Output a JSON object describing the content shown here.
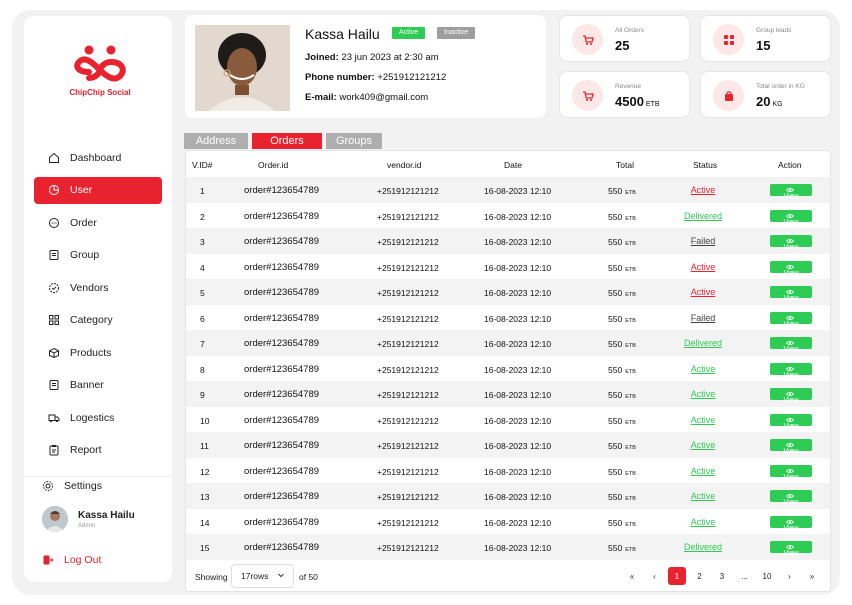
{
  "brand": {
    "name": "ChipChip Social",
    "color": "#e8232f"
  },
  "sidebar": {
    "items": [
      {
        "label": "Dashboard",
        "icon": "home-icon"
      },
      {
        "label": "User",
        "icon": "user-pie-icon"
      },
      {
        "label": "Order",
        "icon": "chat-icon"
      },
      {
        "label": "Group",
        "icon": "document-icon"
      },
      {
        "label": "Vendors",
        "icon": "badge-icon"
      },
      {
        "label": "Category",
        "icon": "grid-icon"
      },
      {
        "label": "Products",
        "icon": "box-icon"
      },
      {
        "label": "Banner",
        "icon": "document-icon"
      },
      {
        "label": "Logestics",
        "icon": "truck-icon"
      },
      {
        "label": "Report",
        "icon": "clipboard-icon"
      }
    ],
    "active_index": 1,
    "settings_label": "Settings",
    "user": {
      "name": "Kassa Hailu",
      "role": "Admin"
    },
    "logout_label": "Log Out"
  },
  "profile": {
    "name": "Kassa Hailu",
    "active_label": "Active",
    "inactive_label": "Inactive",
    "joined_label": "Joined:",
    "joined_value": "23 jun 2023 at 2:30 am",
    "phone_label": "Phone number:",
    "phone_value": "+251912121212",
    "email_label": "E-mail:",
    "email_value": "work409@gmail.com"
  },
  "stats": [
    {
      "label": "All Orders",
      "value": "25",
      "unit": "",
      "icon": "cart-icon"
    },
    {
      "label": "Group leads",
      "value": "15",
      "unit": "",
      "icon": "grid-icon"
    },
    {
      "label": "Revenue",
      "value": "4500",
      "unit": "ETB",
      "icon": "cart-icon"
    },
    {
      "label": "Total order in KG",
      "value": "20",
      "unit": "KG",
      "icon": "bag-icon"
    }
  ],
  "tabs": [
    "Address",
    "Orders",
    "Groups"
  ],
  "selected_tab": "Orders",
  "table": {
    "headers": [
      "V.ID#",
      "Order.id",
      "vendor.id",
      "Date",
      "Total",
      "Status",
      "Action"
    ],
    "rows": [
      {
        "vid": "1",
        "order": "order#123654789",
        "vendor": "+251912121212",
        "date": "16-08-2023 12:10",
        "total": "550",
        "currency": "ETB",
        "status": "Active",
        "action": "View"
      },
      {
        "vid": "2",
        "order": "order#123654789",
        "vendor": "+251912121212",
        "date": "16-08-2023 12:10",
        "total": "550",
        "currency": "ETB",
        "status": "Delivered",
        "action": "View"
      },
      {
        "vid": "3",
        "order": "order#123654789",
        "vendor": "+251912121212",
        "date": "16-08-2023 12:10",
        "total": "550",
        "currency": "ETB",
        "status": "Failed",
        "action": "View"
      },
      {
        "vid": "4",
        "order": "order#123654789",
        "vendor": "+251912121212",
        "date": "16-08-2023 12:10",
        "total": "550",
        "currency": "ETB",
        "status": "Active",
        "action": "View"
      },
      {
        "vid": "5",
        "order": "order#123654789",
        "vendor": "+251912121212",
        "date": "16-08-2023 12:10",
        "total": "550",
        "currency": "ETB",
        "status": "Active",
        "action": "View"
      },
      {
        "vid": "6",
        "order": "order#123654789",
        "vendor": "+251912121212",
        "date": "16-08-2023 12:10",
        "total": "550",
        "currency": "ETB",
        "status": "Failed",
        "action": "View"
      },
      {
        "vid": "7",
        "order": "order#123654789",
        "vendor": "+251912121212",
        "date": "16-08-2023 12:10",
        "total": "550",
        "currency": "ETB",
        "status": "Delivered",
        "action": "View"
      },
      {
        "vid": "8",
        "order": "order#123654789",
        "vendor": "+251912121212",
        "date": "16-08-2023 12:10",
        "total": "550",
        "currency": "ETB",
        "status": "Active",
        "action": "View"
      },
      {
        "vid": "9",
        "order": "order#123654789",
        "vendor": "+251912121212",
        "date": "16-08-2023 12:10",
        "total": "550",
        "currency": "ETB",
        "status": "Active",
        "action": "View"
      },
      {
        "vid": "10",
        "order": "order#123654789",
        "vendor": "+251912121212",
        "date": "16-08-2023 12:10",
        "total": "550",
        "currency": "ETB",
        "status": "Active",
        "action": "View"
      },
      {
        "vid": "11",
        "order": "order#123654789",
        "vendor": "+251912121212",
        "date": "16-08-2023 12:10",
        "total": "550",
        "currency": "ETB",
        "status": "Active",
        "action": "View"
      },
      {
        "vid": "12",
        "order": "order#123654789",
        "vendor": "+251912121212",
        "date": "16-08-2023 12:10",
        "total": "550",
        "currency": "ETB",
        "status": "Active",
        "action": "View"
      },
      {
        "vid": "13",
        "order": "order#123654789",
        "vendor": "+251912121212",
        "date": "16-08-2023 12:10",
        "total": "550",
        "currency": "ETB",
        "status": "Active",
        "action": "View"
      },
      {
        "vid": "14",
        "order": "order#123654789",
        "vendor": "+251912121212",
        "date": "16-08-2023 12:10",
        "total": "550",
        "currency": "ETB",
        "status": "Active",
        "action": "View"
      },
      {
        "vid": "15",
        "order": "order#123654789",
        "vendor": "+251912121212",
        "date": "16-08-2023 12:10",
        "total": "550",
        "currency": "ETB",
        "status": "Delivered",
        "action": "View"
      }
    ]
  },
  "pagination": {
    "showing_label": "Showing",
    "rows_value": "17rows",
    "of_label": "of 50",
    "first": "«",
    "prev": "‹",
    "pages": [
      "1",
      "2",
      "3",
      "...",
      "10"
    ],
    "current": "1",
    "next": "›",
    "last": "»"
  },
  "colors": {
    "accent": "#e8232f",
    "success": "#2ecc55",
    "muted": "#aeaeae"
  }
}
